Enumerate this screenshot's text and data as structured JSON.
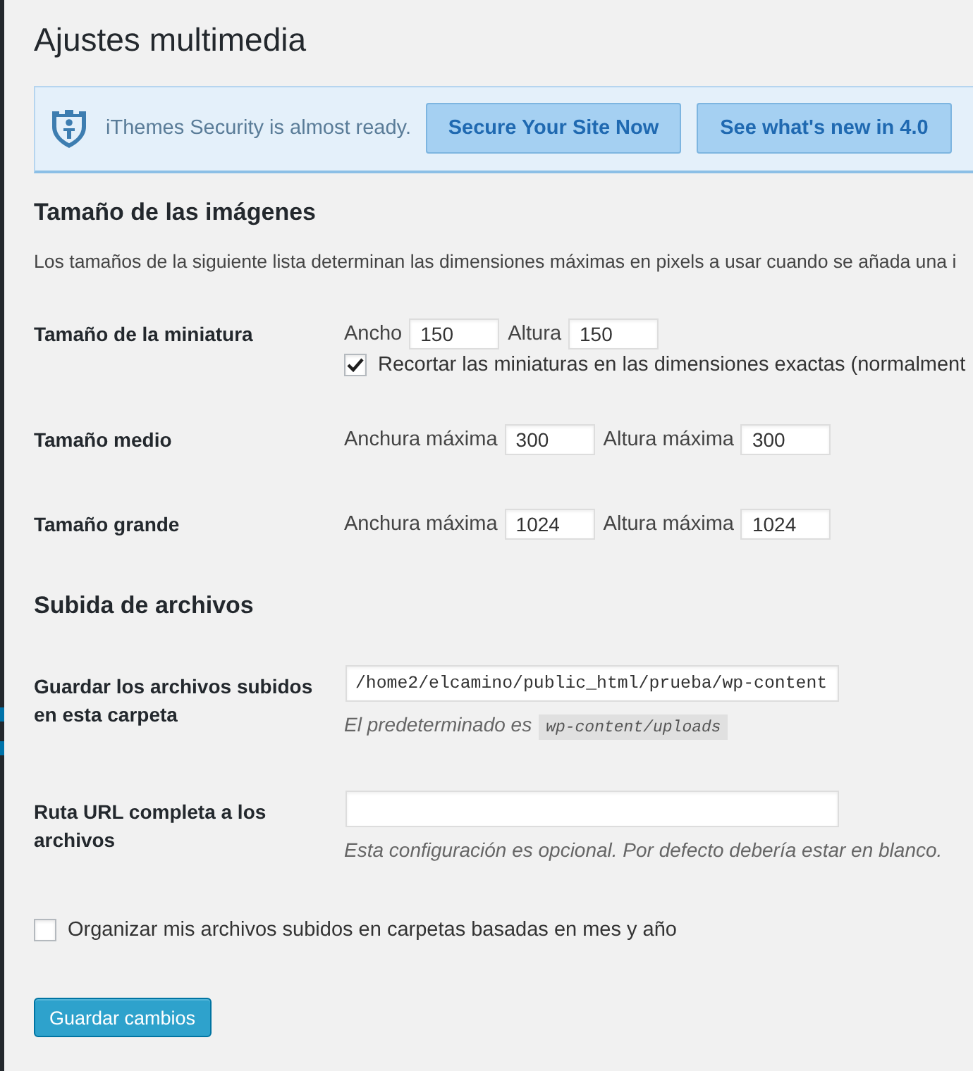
{
  "page": {
    "title": "Ajustes multimedia"
  },
  "notice": {
    "message": "iThemes Security is almost ready.",
    "buttons": [
      "Secure Your Site Now",
      "See what's new in 4.0"
    ]
  },
  "image_sizes": {
    "heading": "Tamaño de las imágenes",
    "description": "Los tamaños de la siguiente lista determinan las dimensiones máximas en pixels a usar cuando se añada una i",
    "rows": [
      {
        "label": "Tamaño de la miniatura",
        "fields": [
          {
            "label": "Ancho",
            "value": "150"
          },
          {
            "label": "Altura",
            "value": "150"
          }
        ],
        "crop": {
          "label": "Recortar las miniaturas en las dimensiones exactas (normalment",
          "checked": true
        }
      },
      {
        "label": "Tamaño medio",
        "fields": [
          {
            "label": "Anchura máxima",
            "value": "300"
          },
          {
            "label": "Altura máxima",
            "value": "300"
          }
        ]
      },
      {
        "label": "Tamaño grande",
        "fields": [
          {
            "label": "Anchura máxima",
            "value": "1024"
          },
          {
            "label": "Altura máxima",
            "value": "1024"
          }
        ]
      }
    ]
  },
  "uploads": {
    "heading": "Subida de archivos",
    "rows": [
      {
        "label": "Guardar los archivos subidos en esta carpeta",
        "value": "/home2/elcamino/public_html/prueba/wp-content",
        "hint": {
          "text": "El predeterminado es",
          "code": "wp-content/uploads"
        }
      },
      {
        "label": "Ruta URL completa a los archivos",
        "hint": {
          "text": "Esta configuración es opcional. Por defecto debería estar en blanco."
        }
      }
    ],
    "organize": {
      "label": "Organizar mis archivos subidos en carpetas basadas en mes y año",
      "checked": false
    }
  },
  "submit": {
    "label": "Guardar cambios"
  }
}
